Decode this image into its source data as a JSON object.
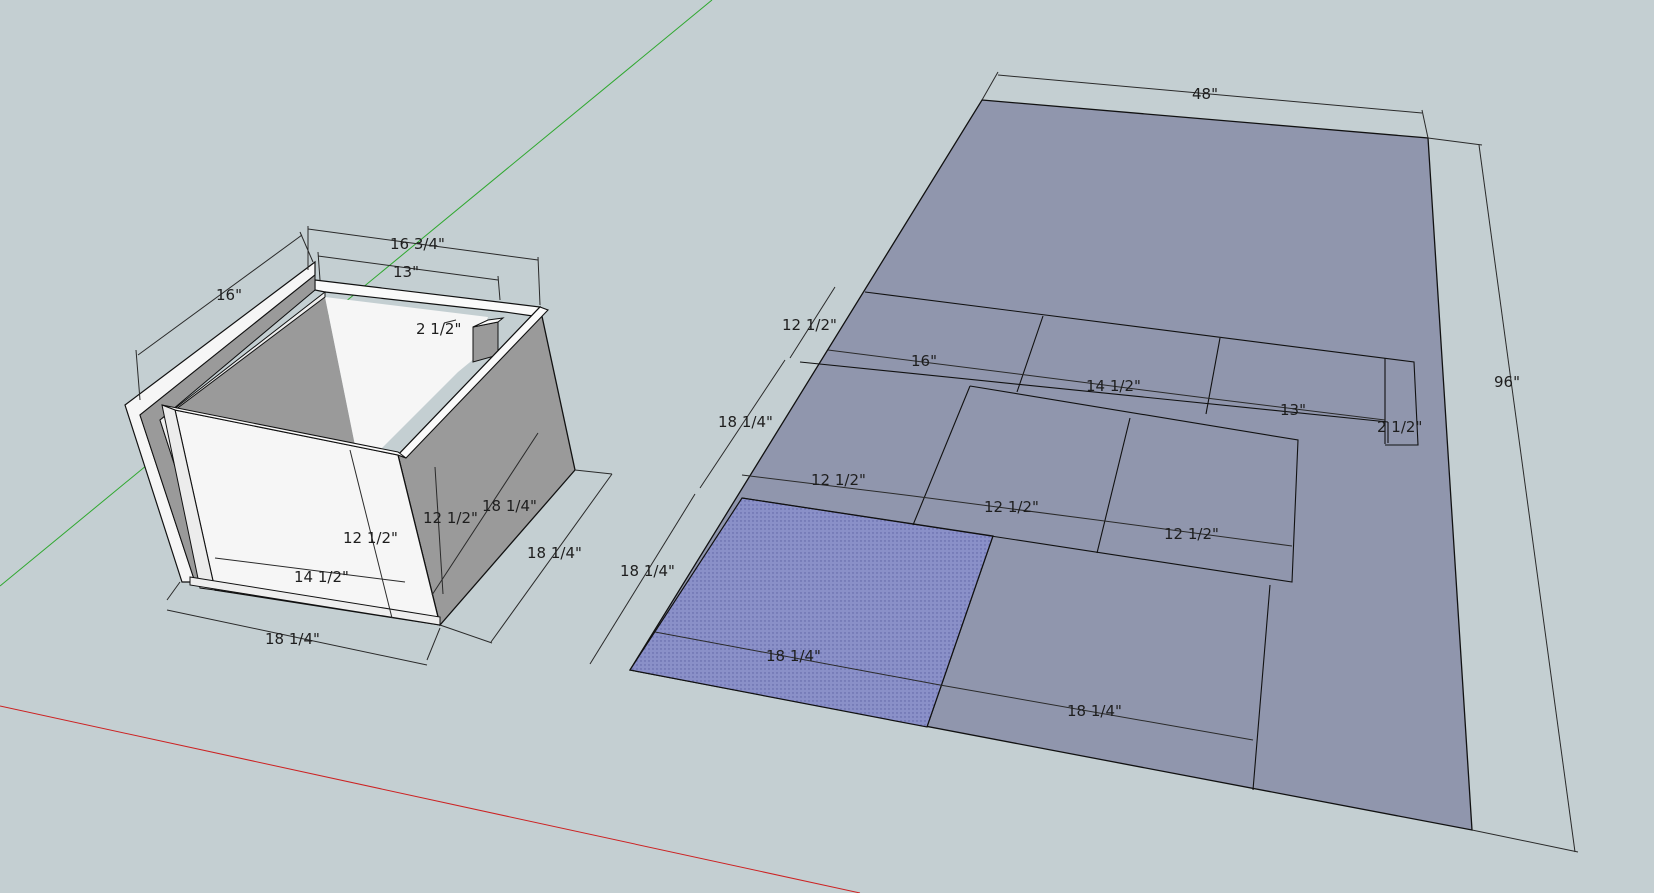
{
  "colors": {
    "background": "#c4cfd2",
    "sheet": "#9096ad",
    "selected_piece": "#8a90c8",
    "panel_face": "#f4f4f4",
    "panel_shadow": "#9a9a9a",
    "axis_green": "#2fa82f",
    "axis_red": "#cc2222"
  },
  "box_dimensions": {
    "outer_width_top": "16 3/4\"",
    "inner_width_top": "13\"",
    "side_depth_top": "16\"",
    "divider_thickness": "2 1/2\"",
    "panel_height_front": "12 1/2\"",
    "panel_height_side": "12 1/2\"",
    "side_diagonal": "18 1/4\"",
    "front_inner_width": "14 1/2\"",
    "bottom_width": "18 1/4\"",
    "bottom_depth": "18 1/4\""
  },
  "sheet_dimensions": {
    "width": "48\"",
    "length": "96\"",
    "row1_height": "12 1/2\"",
    "row1_p1": "16\"",
    "row1_p2": "14 1/2\"",
    "row1_p3": "13\"",
    "row1_p4": "2 1/2\"",
    "row2_height": "18 1/4\"",
    "row2_p1": "12 1/2\"",
    "row2_p2": "12 1/2\"",
    "row2_p3": "12 1/2\"",
    "row3_height": "18 1/4\"",
    "row3_p1": "18 1/4\"",
    "row3_p2": "18 1/4\""
  }
}
